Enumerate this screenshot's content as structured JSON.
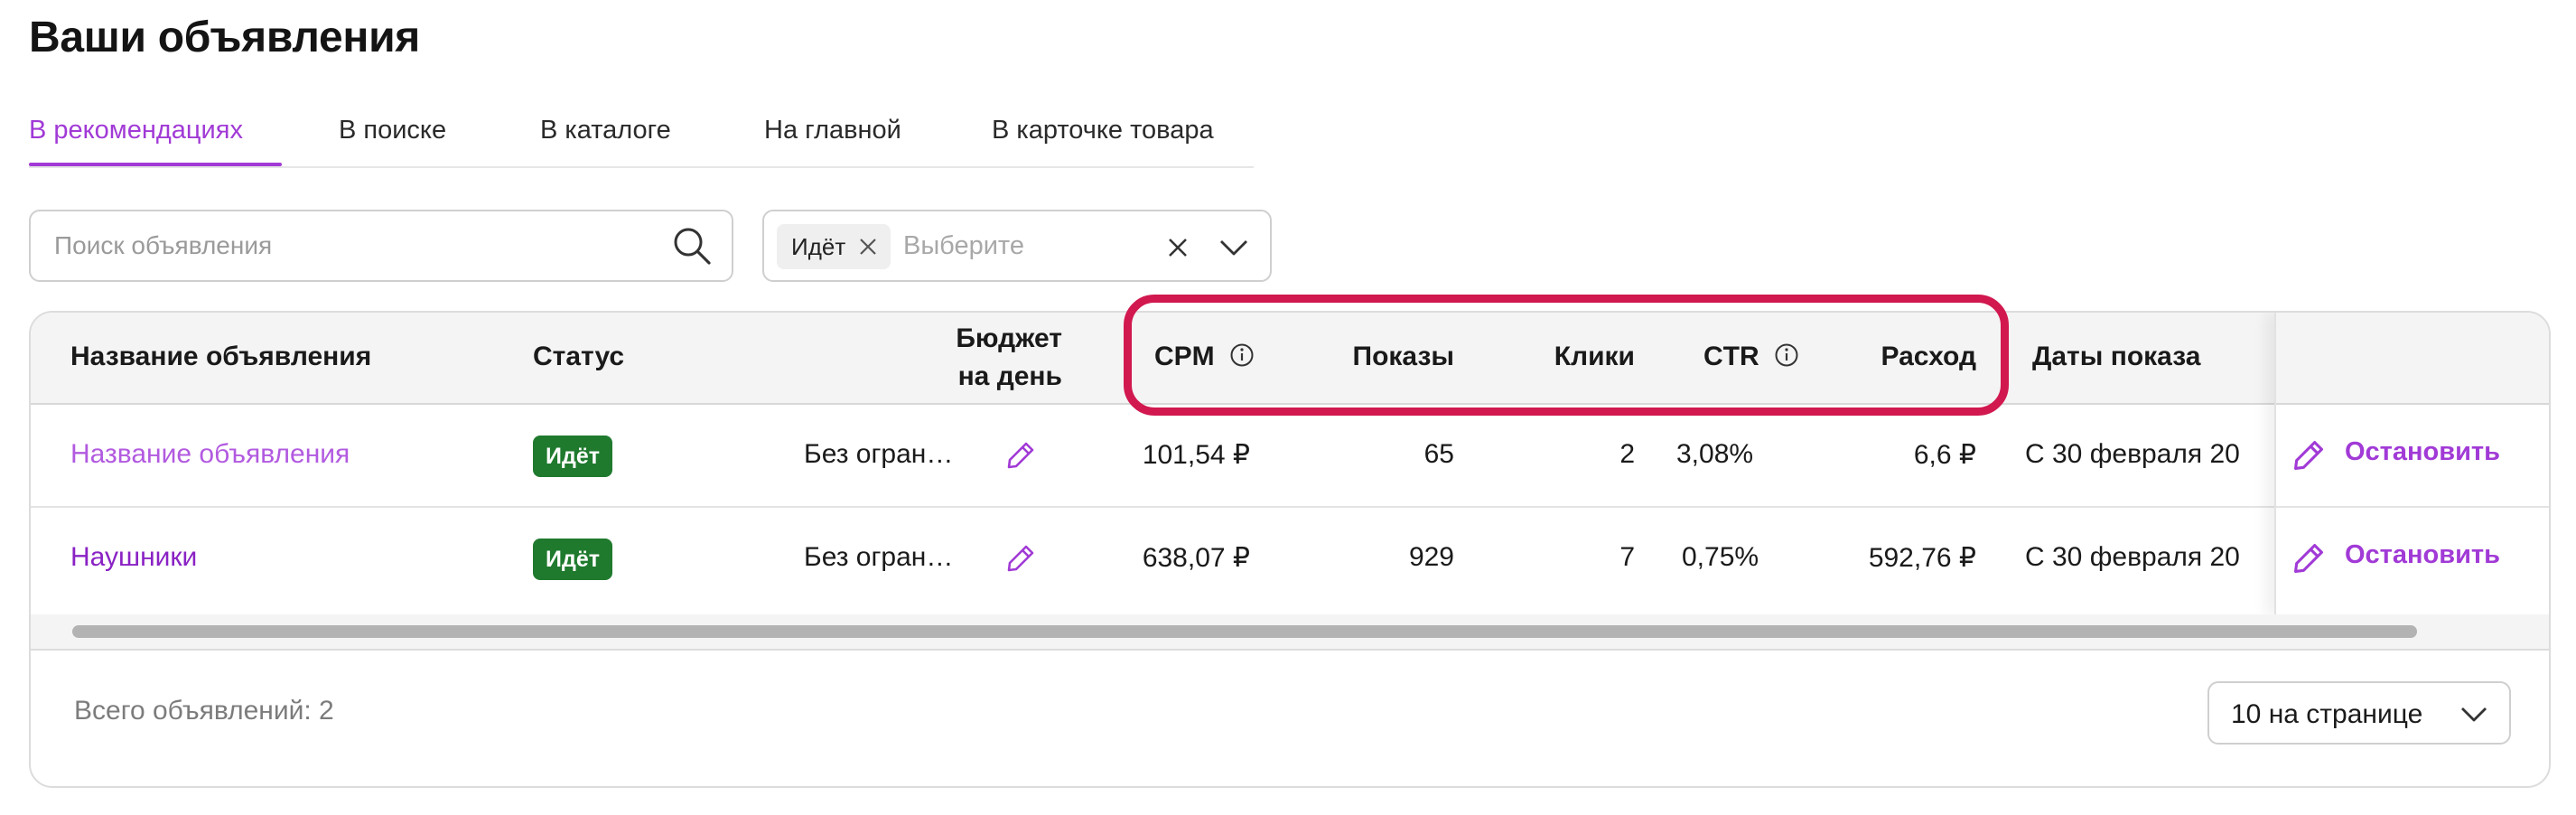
{
  "page": {
    "title": "Ваши объявления"
  },
  "tabs": [
    {
      "label": "В рекомендациях",
      "active": true
    },
    {
      "label": "В поиске"
    },
    {
      "label": "В каталоге"
    },
    {
      "label": "На главной"
    },
    {
      "label": "В карточке товара"
    }
  ],
  "search": {
    "placeholder": "Поиск объявления",
    "value": "",
    "icon": "search-icon"
  },
  "status_filter": {
    "chip": "Идёт",
    "placeholder": "Выберите"
  },
  "table": {
    "columns": {
      "name": "Название объявления",
      "status": "Статус",
      "budget_line1": "Бюджет",
      "budget_line2": "на день",
      "cpm": "CPM",
      "shows": "Показы",
      "clicks": "Клики",
      "ctr": "CTR",
      "spend": "Расход",
      "dates": "Даты показа"
    },
    "rows": [
      {
        "name": "Название объявления",
        "status": "Идёт",
        "budget": "Без огран…",
        "cpm": "101,54 ₽",
        "shows": "65",
        "clicks": "2",
        "ctr": "3,08%",
        "spend": "6,6 ₽",
        "dates": "С 30 февраля 20",
        "action": "Остановить"
      },
      {
        "name": "Наушники",
        "status": "Идёт",
        "budget": "Без огран…",
        "cpm": "638,07 ₽",
        "shows": "929",
        "clicks": "7",
        "ctr": "0,75%",
        "spend": "592,76 ₽",
        "dates": "С 30 февраля 20",
        "action": "Остановить"
      }
    ]
  },
  "footer": {
    "total": "Всего объявлений: 2",
    "per_page": "10 на странице"
  },
  "colors": {
    "accent": "#a13ad6",
    "status_green": "#1f7a2e",
    "highlight": "#d1184f"
  }
}
